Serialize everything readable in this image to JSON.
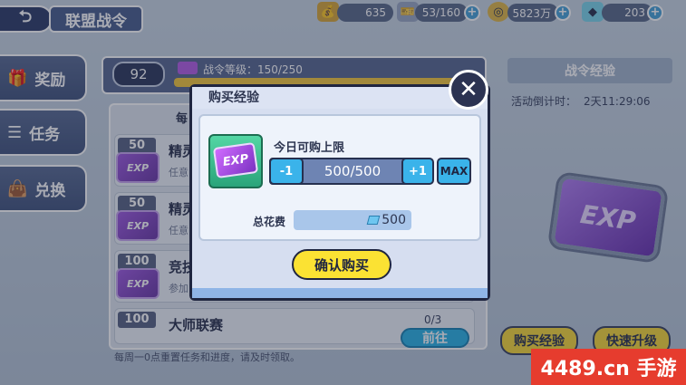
{
  "header": {
    "back_icon": "back-arrow-icon",
    "title": "联盟战令"
  },
  "resources": [
    {
      "icon": "coin-bag-icon",
      "value": "635",
      "color": "#d8a93a"
    },
    {
      "icon": "ticket-icon",
      "value": "53/160",
      "color": "#9aa8c4"
    },
    {
      "icon": "gold-coin-icon",
      "value": "5823万",
      "color": "#e1b94a"
    },
    {
      "icon": "diamond-icon",
      "value": "203",
      "color": "#7cd5ea"
    }
  ],
  "nav": [
    {
      "label": "奖励",
      "icon": "gift-icon"
    },
    {
      "label": "任务",
      "icon": "list-icon"
    },
    {
      "label": "兑换",
      "icon": "bag-icon"
    }
  ],
  "level": {
    "number": "92",
    "label": "战令等级：150/250",
    "progress": 1.0
  },
  "tasks": [
    {
      "points": "50",
      "name": "精灵",
      "sub": "任意"
    },
    {
      "points": "50",
      "name": "精灵",
      "sub": "任意"
    },
    {
      "points": "100",
      "name": "竞技",
      "sub": "参加"
    },
    {
      "points": "100",
      "name": "大师联赛",
      "sub": "",
      "progress": "0/3",
      "action": "前往"
    }
  ],
  "list_tab_partial": "每",
  "footer_note": "每周一0点重置任务和进度，请及时领取。",
  "right_panel": {
    "title": "战令经验",
    "timer_label": "活动倒计时：",
    "timer": "2天11:29:06",
    "exp_badge": "EXP",
    "buy_btn": "购买经验",
    "upgrade_btn": "快速升级"
  },
  "modal": {
    "title": "购买经验",
    "close_icon": "close-icon",
    "item_badge": "EXP",
    "limit_label": "今日可购上限",
    "minus": "-1",
    "quantity": "500/500",
    "plus": "+1",
    "max": "MAX",
    "cost_label": "总花费",
    "cost_value": "500",
    "confirm": "确认购买"
  },
  "watermark": "4489.cn 手游"
}
